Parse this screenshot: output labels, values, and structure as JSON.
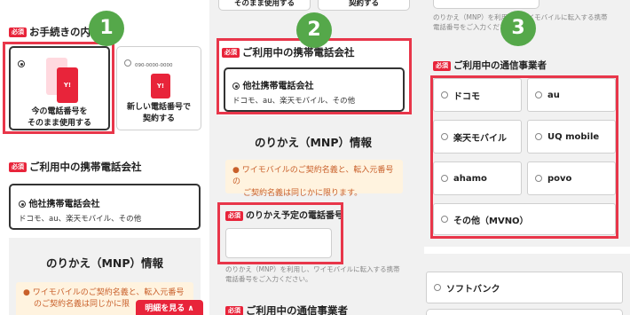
{
  "required_badge": "必須",
  "step_numbers": [
    "1",
    "2",
    "3"
  ],
  "panel1": {
    "section_title": "お手続きの内容",
    "option_keep": {
      "line1": "今の電話番号を",
      "line2": "そのまま使用する",
      "phone_badge": "Y!"
    },
    "option_new": {
      "line1": "新しい電話番号で",
      "line2": "契約する",
      "sample_number": "090-0000-0000",
      "phone_badge": "Y!"
    },
    "carrier_title": "ご利用中の携帯電話会社",
    "carrier_option": {
      "label": "他社携帯電話会社",
      "sub": "ドコモ、au、楽天モバイル、その他"
    },
    "mnp_title": "のりかえ（MNP）情報",
    "notice_line1": "ワイモバイルのご契約名義と、転入元番号",
    "notice_line2": "のご契約名義は同じかに限",
    "details_button": "明細を見る ∧"
  },
  "panel2": {
    "top_button_left": "そのまま使用する",
    "top_button_right": "契約する",
    "carrier_title": "ご利用中の携帯電話会社",
    "carrier_option": {
      "label": "他社携帯電話会社",
      "sub": "ドコモ、au、楽天モバイル、その他"
    },
    "mnp_title": "のりかえ（MNP）情報",
    "notice_line1": "ワイモバイルのご契約名義と、転入元番号の",
    "notice_line2": "ご契約名義は同じかに限ります。",
    "phone_field_label": "のりかえ予定の電話番号",
    "phone_field_value": "",
    "hint_line1": "のりかえ（MNP）を利用し、ワイモバイルに転入する携帯",
    "hint_line2": "電話番号をご入力ください。",
    "bottom_title": "ご利用中の通信事業者"
  },
  "panel3": {
    "hint_line1": "のりかえ（MNP）を利用し、ワイモバイルに転入する携帯",
    "hint_line2": "電話番号をご入力ください。",
    "section_title": "ご利用中の通信事業者",
    "carriers": [
      "ドコモ",
      "au",
      "楽天モバイル",
      "UQ mobile",
      "ahamo",
      "povo",
      "その他（MVNO）"
    ],
    "softbank": "ソフトバンク"
  }
}
